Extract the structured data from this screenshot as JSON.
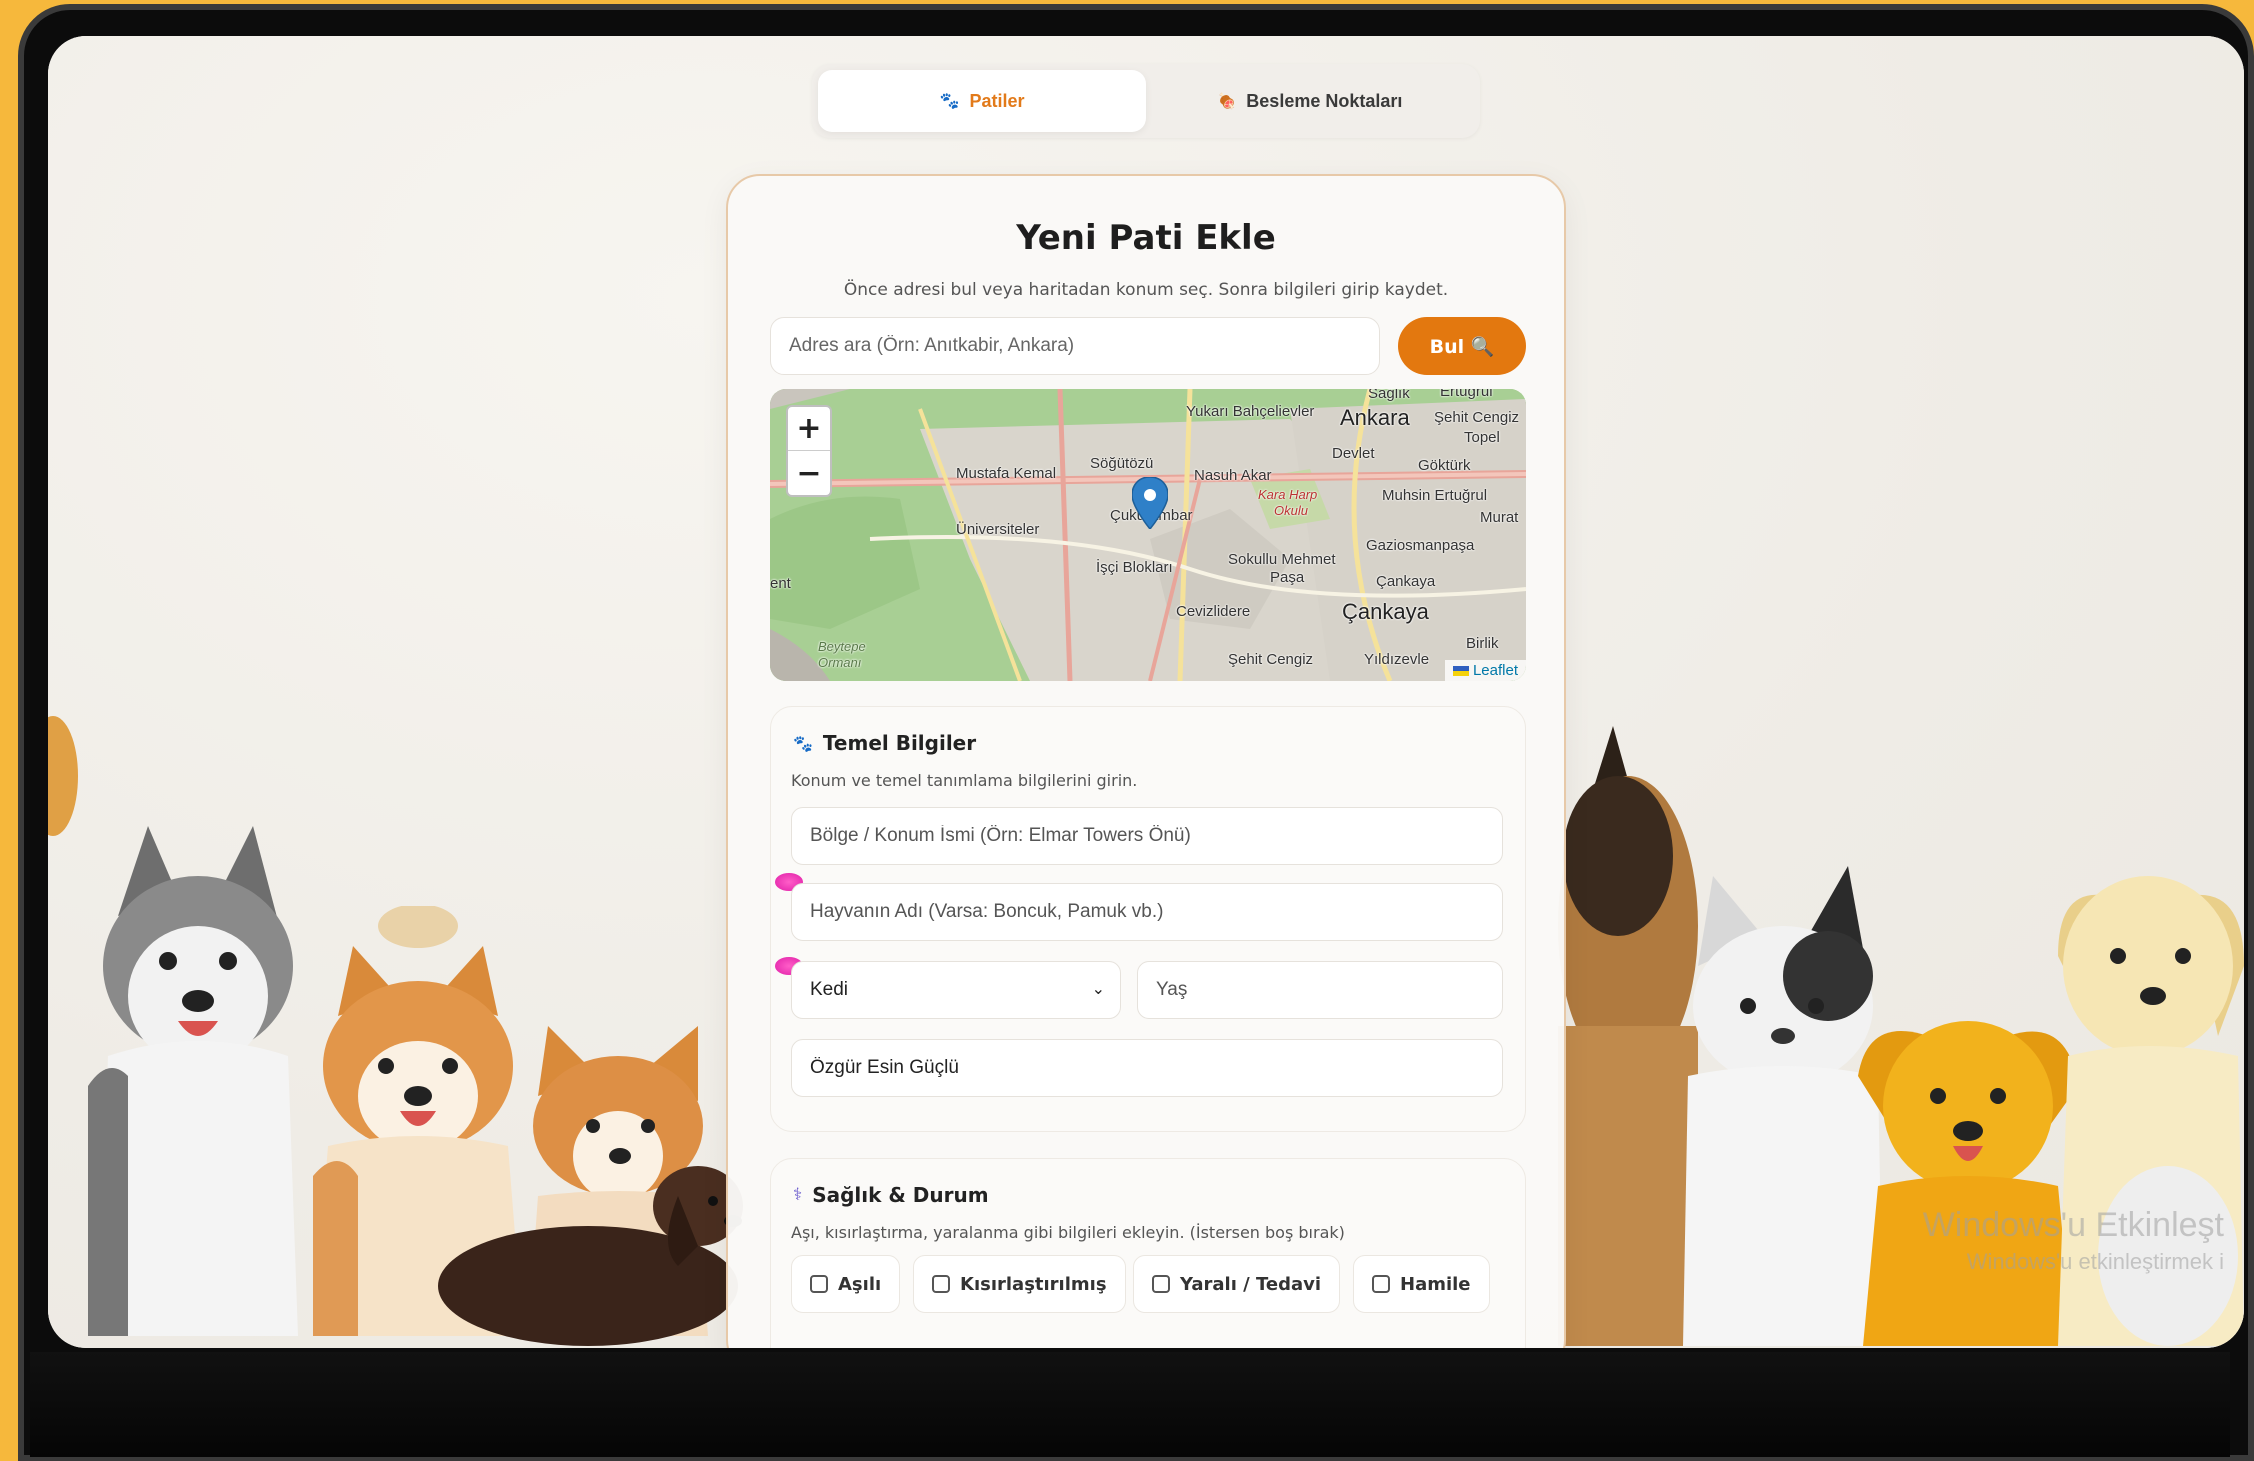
{
  "tabs": [
    {
      "label": "Patiler",
      "active": true,
      "icon": "paw-icon"
    },
    {
      "label": "Besleme Noktaları",
      "active": false,
      "icon": "food-bowl-icon"
    }
  ],
  "card": {
    "title": "Yeni Pati Ekle",
    "subtitle": "Önce adresi bul veya haritadan konum seç. Sonra bilgileri girip kaydet."
  },
  "search": {
    "placeholder": "Adres ara (Örn: Anıtkabir, Ankara)",
    "button_label": "Bul 🔍"
  },
  "map": {
    "zoom_in": "+",
    "zoom_out": "−",
    "attribution": "Leaflet",
    "labels": {
      "ankara": "Ankara",
      "yukari_bahcelievler": "Yukarı Bahçelievler",
      "saglik": "Sağlık",
      "ertugrul": "Ertuğrul",
      "sehit_cengiz_topel": "Şehit Cengiz",
      "topel": "Topel",
      "devlet": "Devlet",
      "gokturk": "Göktürk",
      "mustafa_kemal": "Mustafa Kemal",
      "sogutozu": "Söğütözü",
      "nasuh_akar": "Nasuh Akar",
      "kara_harp": "Kara Harp",
      "okulu": "Okulu",
      "muhsin_ertugrul": "Muhsin Ertuğrul",
      "cukurambar": "Çukurambar",
      "universiteler": "Üniversiteler",
      "murat": "Murat",
      "isci_bloklari": "İşçi Blokları",
      "gaziosmanpasa": "Gaziosmanpaşa",
      "sokullu": "Sokullu Mehmet",
      "pasa": "Paşa",
      "cankaya_small": "Çankaya",
      "cankaya_big": "Çankaya",
      "cevizlidere": "Cevizlidere",
      "sehit_cengiz": "Şehit Cengiz",
      "yildizevler": "Yıldızevle",
      "birlik": "Birlik",
      "beytepe": "Beytepe",
      "ormani": "Ormanı",
      "kent": "ent"
    }
  },
  "basic": {
    "title": "Temel Bilgiler",
    "description": "Konum ve temel tanımlama bilgilerini girin.",
    "location_placeholder": "Bölge / Konum İsmi (Örn: Elmar Towers Önü)",
    "name_placeholder": "Hayvanın Adı (Varsa: Boncuk, Pamuk vb.)",
    "species_value": "Kedi",
    "age_placeholder": "Yaş",
    "owner_value": "Özgür Esin Güçlü"
  },
  "health": {
    "title": "Sağlık & Durum",
    "description": "Aşı, kısırlaştırma, yaralanma gibi bilgileri ekleyin. (İstersen boş bırak)",
    "checks": [
      "Aşılı",
      "Kısırlaştırılmış",
      "Yaralı / Tedavi",
      "Hamile"
    ]
  },
  "watermark": {
    "line1": "Windows'u Etkinleşt",
    "line2": "Windows'u etkinleştirmek i"
  }
}
